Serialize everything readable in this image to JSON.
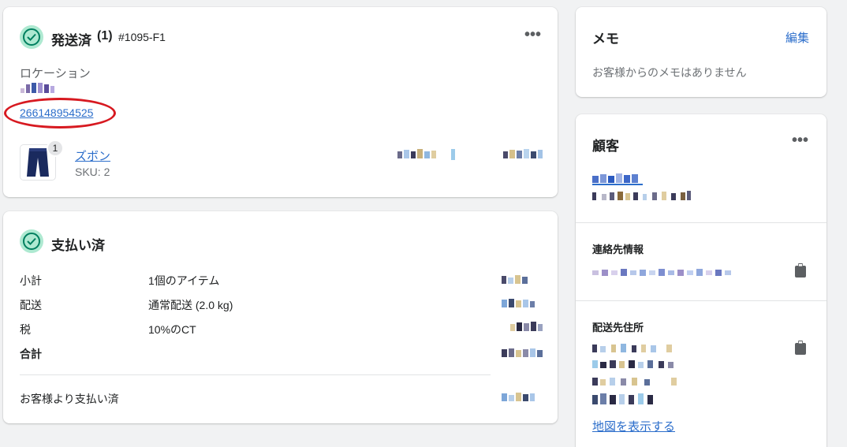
{
  "fulfillment": {
    "status_title": "発送済",
    "count": "(1)",
    "order_id": "#1095-F1",
    "location_label": "ロケーション",
    "tracking_number": "266148954525",
    "item": {
      "name": "ズボン",
      "sku": "SKU: 2",
      "quantity": "1"
    }
  },
  "payment": {
    "status_title": "支払い済",
    "rows": [
      {
        "label": "小計",
        "detail": "1個のアイテム"
      },
      {
        "label": "配送",
        "detail": "通常配送 (2.0 kg)"
      },
      {
        "label": "税",
        "detail": "10%のCT"
      },
      {
        "label": "合計",
        "detail": ""
      }
    ],
    "paid_by_customer": "お客様より支払い済"
  },
  "memo": {
    "title": "メモ",
    "edit_label": "編集",
    "empty_text": "お客様からのメモはありません"
  },
  "customer": {
    "title": "顧客",
    "contact_title": "連絡先情報",
    "shipping_title": "配送先住所",
    "map_link": "地図を表示する"
  },
  "colors": {
    "link": "#2c6ecb",
    "success_bg": "#aee9d1",
    "success_stroke": "#007f5f",
    "annotation_red": "#d71920"
  }
}
